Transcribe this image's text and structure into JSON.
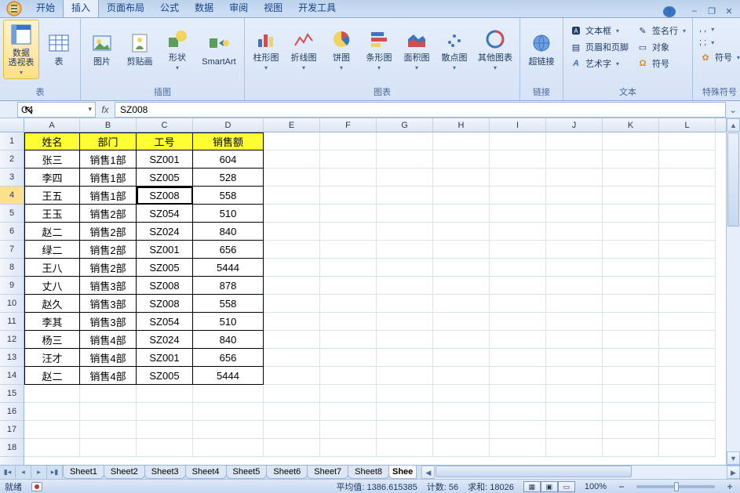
{
  "tabs": {
    "start": "开始",
    "insert": "插入",
    "layout": "页面布局",
    "formula": "公式",
    "data": "数据",
    "review": "审阅",
    "view": "视图",
    "dev": "开发工具"
  },
  "ribbon": {
    "tables": {
      "pivot": "数据\n透视表",
      "table": "表",
      "label": "表"
    },
    "illust": {
      "pic": "图片",
      "clip": "剪贴画",
      "shape": "形状",
      "smartart": "SmartArt",
      "label": "插图"
    },
    "charts": {
      "column": "柱形图",
      "line": "折线图",
      "pie": "饼图",
      "bar": "条形图",
      "area": "面积图",
      "scatter": "散点图",
      "other": "其他图表",
      "label": "图表"
    },
    "links": {
      "hyper": "超链接",
      "label": "链接"
    },
    "text": {
      "textbox": "文本框",
      "headerfooter": "页眉和页脚",
      "wordart": "艺术字",
      "sigline": "签名行",
      "object": "对象",
      "symbol": "符号",
      "label": "文本"
    },
    "special": {
      "comma": ", ,",
      "semi": "; ;",
      "sym": "符号",
      "label": "特殊符号"
    }
  },
  "namebox": "C4",
  "formula": "SZ008",
  "colWidths": {
    "A": 71,
    "B": 72,
    "C": 72,
    "D": 90,
    "E": 72,
    "F": 72,
    "G": 72,
    "H": 72,
    "I": 72,
    "J": 72,
    "K": 72,
    "L": 72
  },
  "columns": [
    "A",
    "B",
    "C",
    "D",
    "E",
    "F",
    "G",
    "H",
    "I",
    "J",
    "K",
    "L"
  ],
  "headers": [
    "姓名",
    "部门",
    "工号",
    "销售额"
  ],
  "rows": [
    [
      "张三",
      "销售1部",
      "SZ001",
      "604"
    ],
    [
      "李四",
      "销售1部",
      "SZ005",
      "528"
    ],
    [
      "王五",
      "销售1部",
      "SZ008",
      "558"
    ],
    [
      "王玉",
      "销售2部",
      "SZ054",
      "510"
    ],
    [
      "赵二",
      "销售2部",
      "SZ024",
      "840"
    ],
    [
      "绿二",
      "销售2部",
      "SZ001",
      "656"
    ],
    [
      "王八",
      "销售2部",
      "SZ005",
      "5444"
    ],
    [
      "丈八",
      "销售3部",
      "SZ008",
      "878"
    ],
    [
      "赵久",
      "销售3部",
      "SZ008",
      "558"
    ],
    [
      "李其",
      "销售3部",
      "SZ054",
      "510"
    ],
    [
      "杨三",
      "销售4部",
      "SZ024",
      "840"
    ],
    [
      "汪才",
      "销售4部",
      "SZ001",
      "656"
    ],
    [
      "赵二",
      "销售4部",
      "SZ005",
      "5444"
    ]
  ],
  "emptyRows": [
    "15",
    "16",
    "17",
    "18"
  ],
  "activeCell": {
    "row": 4,
    "col": 2
  },
  "sheets": [
    "Sheet1",
    "Sheet2",
    "Sheet3",
    "Sheet4",
    "Sheet5",
    "Sheet6",
    "Sheet7",
    "Sheet8"
  ],
  "sheetTrunc": "Shee",
  "status": {
    "ready": "就绪",
    "avg": "平均值: 1386.615385",
    "count": "计数: 56",
    "sum": "求和: 18026",
    "zoom": "100%"
  }
}
